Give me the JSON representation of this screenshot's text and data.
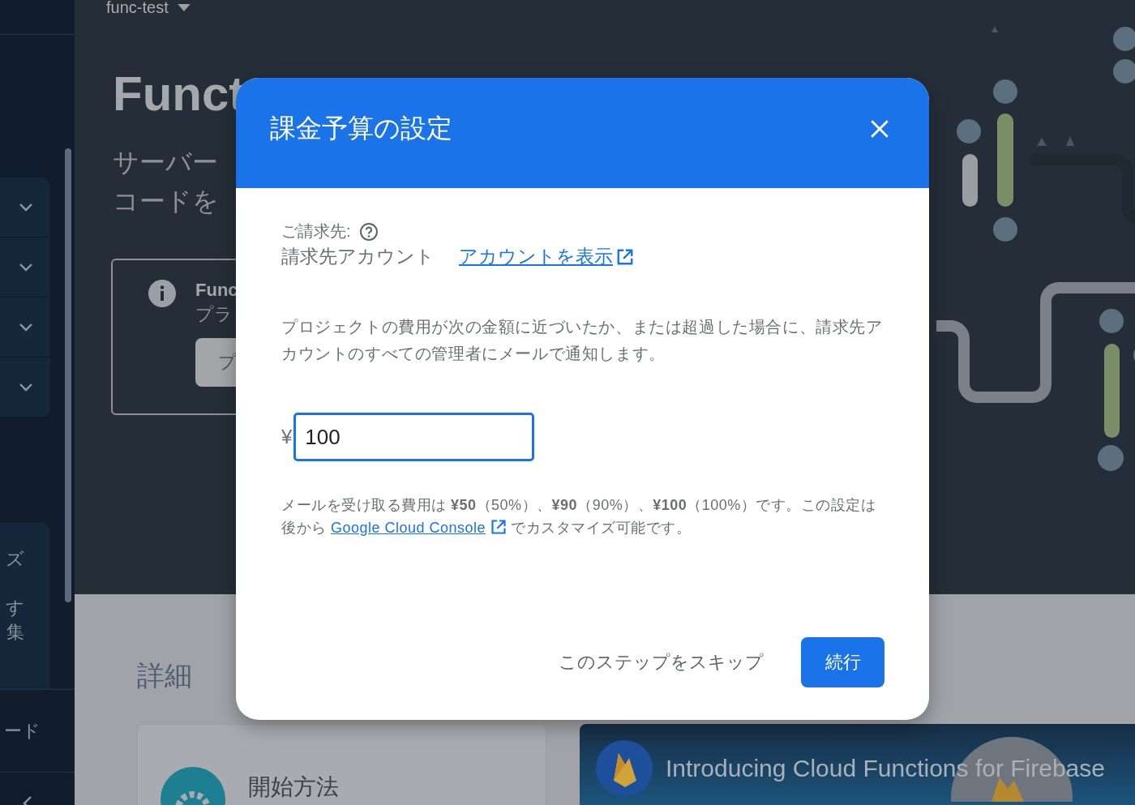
{
  "sidebar": {
    "card_texts": [
      "ズ",
      "す",
      "集"
    ],
    "footer_item": "ード"
  },
  "header": {
    "project": "func-test",
    "title": "Funct",
    "subtitle": [
      "サーバー",
      "コードを"
    ]
  },
  "info_card": {
    "title": "Func",
    "text": "プラ",
    "button": "プ"
  },
  "details": {
    "heading": "詳細",
    "cards": [
      {
        "kind": "plain",
        "title": "開始方法"
      },
      {
        "kind": "banner",
        "title": "Introducing Cloud Functions for Firebase"
      }
    ]
  },
  "dialog": {
    "title": "課金予算の設定",
    "billing_label": "ご請求先:",
    "billing_account": "請求先アカウント",
    "account_link": "アカウントを表示",
    "description": "プロジェクトの費用が次の金額に近づいたか、または超過した場合に、請求先アカウントのすべての管理者にメールで通知します。",
    "currency": "¥",
    "amount": "100",
    "note": "メールを受け取る費用は **¥50**（50%）、**¥90**（90%）、**¥100**（100%）です。この設定は後から",
    "note_link": "Google Cloud Console",
    "note_end": "でカスタマイズ可能です。",
    "skip_button": "このステップをスキップ",
    "continue_button": "続行"
  }
}
